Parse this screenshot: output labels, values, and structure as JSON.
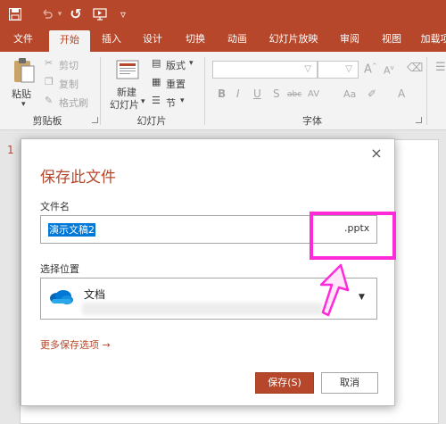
{
  "quick_access": {
    "redo_glyph": "↺",
    "more_glyph": "▿"
  },
  "tabs": [
    "文件",
    "开始",
    "插入",
    "设计",
    "切换",
    "动画",
    "幻灯片放映",
    "审阅",
    "视图",
    "加载项"
  ],
  "ribbon": {
    "clipboard": {
      "paste": "粘贴",
      "cut": "剪切",
      "copy": "复制",
      "format_painter": "格式刷",
      "label": "剪贴板"
    },
    "slides": {
      "new_slide_line1": "新建",
      "new_slide_line2": "幻灯片",
      "layout": "版式",
      "reset": "重置",
      "section": "节",
      "label": "幻灯片"
    },
    "font": {
      "label": "字体",
      "buttons": [
        "B",
        "I",
        "U",
        "S",
        "abc",
        "AV",
        "Aa",
        "A"
      ]
    }
  },
  "workspace": {
    "slide_number": "1"
  },
  "dialog": {
    "title": "保存此文件",
    "close_glyph": "×",
    "filename_label": "文件名",
    "filename_value": "演示文稿2",
    "extension": ".pptx",
    "location_label": "选择位置",
    "location_value": "文档",
    "more_options": "更多保存选项 →",
    "save_button": "保存(S)",
    "cancel_button": "取消"
  },
  "colors": {
    "brand": "#b7472a",
    "highlight": "#ff2bd9",
    "selection": "#0078d7"
  }
}
